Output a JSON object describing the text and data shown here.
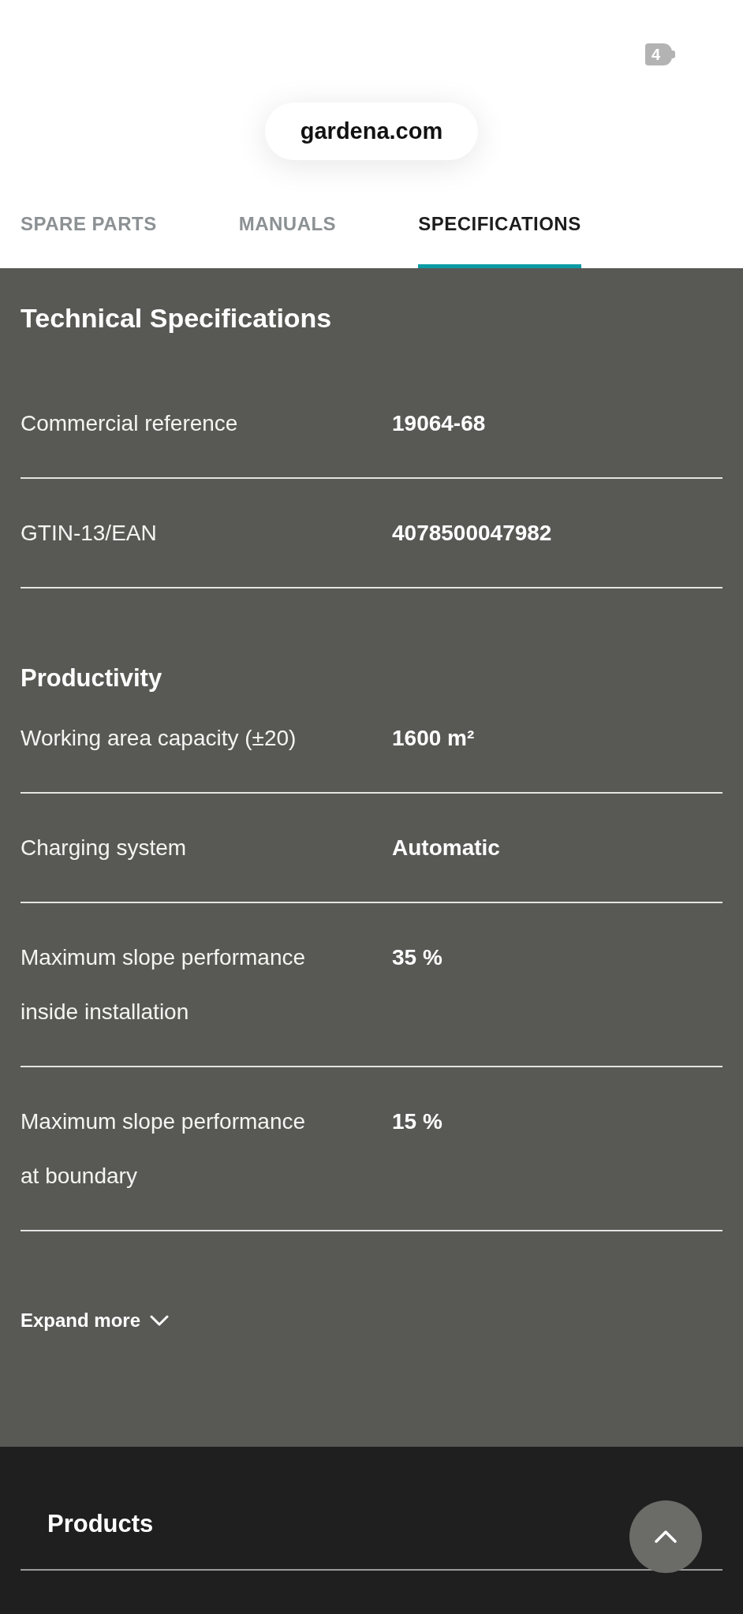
{
  "status_bar": {
    "battery_label": "4"
  },
  "address_bar": {
    "url": "gardena.com"
  },
  "tabs": [
    {
      "label": "SPARE PARTS",
      "selected": false
    },
    {
      "label": "MANUALS",
      "selected": false
    },
    {
      "label": "SPECIFICATIONS",
      "selected": true
    }
  ],
  "specifications": {
    "title": "Technical Specifications",
    "groups": [
      {
        "rows": [
          {
            "label": "Commercial reference",
            "value": "19064-68"
          },
          {
            "label": "GTIN-13/EAN",
            "value": "4078500047982"
          }
        ]
      },
      {
        "heading": "Productivity",
        "rows": [
          {
            "label": "Working area capacity (±20)",
            "value": "1600 m²"
          },
          {
            "label": "Charging system",
            "value": "Automatic"
          },
          {
            "label": "Maximum slope performance inside installation",
            "value": "35 %"
          },
          {
            "label": "Maximum slope performance at boundary",
            "value": "15 %"
          }
        ]
      }
    ],
    "expand_button": {
      "label": "Expand more"
    }
  },
  "footer": {
    "items": [
      {
        "label": "Products"
      }
    ]
  }
}
